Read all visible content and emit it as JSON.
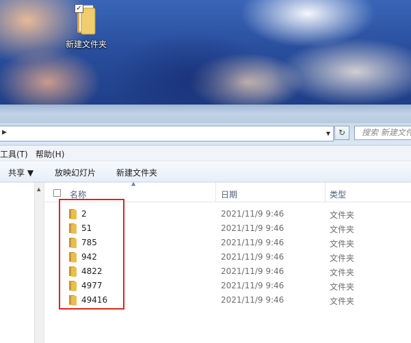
{
  "desktop": {
    "icon_label": "新建文件夹",
    "icon_checkbox": "✓"
  },
  "address": {
    "search_placeholder": "搜索 新建文件"
  },
  "menu": {
    "items": [
      "工具(T)",
      "帮助(H)"
    ]
  },
  "toolbar": {
    "share_label": "共享 ▼",
    "slideshow_label": "放映幻灯片",
    "new_folder_label": "新建文件夹"
  },
  "columns": {
    "name": "名称",
    "date": "日期",
    "type": "类型"
  },
  "files": [
    {
      "name": "2",
      "date": "2021/11/9 9:46",
      "type": "文件夹"
    },
    {
      "name": "51",
      "date": "2021/11/9 9:46",
      "type": "文件夹"
    },
    {
      "name": "785",
      "date": "2021/11/9 9:46",
      "type": "文件夹"
    },
    {
      "name": "942",
      "date": "2021/11/9 9:46",
      "type": "文件夹"
    },
    {
      "name": "4822",
      "date": "2021/11/9 9:46",
      "type": "文件夹"
    },
    {
      "name": "4977",
      "date": "2021/11/9 9:46",
      "type": "文件夹"
    },
    {
      "name": "49416",
      "date": "2021/11/9 9:46",
      "type": "文件夹"
    }
  ],
  "colors": {
    "highlight_border": "#e02020",
    "folder_yellow": "#e8bf4e"
  }
}
